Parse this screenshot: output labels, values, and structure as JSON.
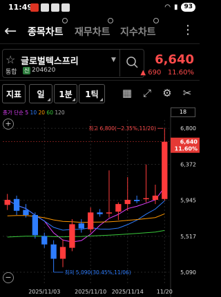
{
  "status": {
    "time": "11:49",
    "battery": "93"
  },
  "nav": {
    "tabs": [
      {
        "label": "종목차트"
      },
      {
        "label": "재무차트"
      },
      {
        "label": "지수차트"
      }
    ]
  },
  "stock": {
    "name": "글로벌텍스프리",
    "market": "통합",
    "credit_badge": "신",
    "code": "204620",
    "price": "6,640",
    "change": "▲ 690",
    "change_pct": "11.60%"
  },
  "toolbar": {
    "indicator": "지표",
    "day": "일",
    "minute": "1분",
    "tick": "1틱"
  },
  "indicators": {
    "prefix": "종가 단순",
    "ma": [
      {
        "label": "5",
        "color": "#e040fb"
      },
      {
        "label": "10",
        "color": "#2e7dff"
      },
      {
        "label": "20",
        "color": "#ff9800"
      },
      {
        "label": "60",
        "color": "#39c93b"
      },
      {
        "label": "120",
        "color": "#aaaaaa"
      }
    ],
    "count_badge": "18"
  },
  "colors": {
    "up": "#ff3b3b",
    "down": "#2e7dff"
  },
  "chart_data": {
    "type": "candlestick",
    "y_ticks": [
      "6,800",
      "6,372",
      "5,945",
      "5,517",
      "5,090"
    ],
    "ylim": [
      5000,
      6900
    ],
    "x_labels": [
      {
        "label": "2025/11/03",
        "index": 4
      },
      {
        "label": "2025/11/10",
        "index": 9
      },
      {
        "label": "2025/11/14",
        "index": 13
      },
      {
        "label": "11/20",
        "index": 17
      }
    ],
    "high_annotation": "최고 6,800(−2.35%,11/20)",
    "low_annotation": "최저 5,090(30.45%,11/06)",
    "current_price_label": "6,640",
    "current_pct_label": "11.60%",
    "candles": [
      {
        "o": 5890,
        "h": 6020,
        "l": 5830,
        "c": 5950
      },
      {
        "o": 5960,
        "h": 6000,
        "l": 5770,
        "c": 5820
      },
      {
        "o": 5830,
        "h": 5900,
        "l": 5740,
        "c": 5770
      },
      {
        "o": 5770,
        "h": 5800,
        "l": 5490,
        "c": 5530
      },
      {
        "o": 5520,
        "h": 5560,
        "l": 5380,
        "c": 5420
      },
      {
        "o": 5420,
        "h": 5470,
        "l": 5090,
        "c": 5250
      },
      {
        "o": 5250,
        "h": 5480,
        "l": 5150,
        "c": 5390
      },
      {
        "o": 5380,
        "h": 5720,
        "l": 5340,
        "c": 5660
      },
      {
        "o": 5670,
        "h": 5720,
        "l": 5560,
        "c": 5610
      },
      {
        "o": 5600,
        "h": 5860,
        "l": 5560,
        "c": 5800
      },
      {
        "o": 5800,
        "h": 5840,
        "l": 5750,
        "c": 5780
      },
      {
        "o": 5790,
        "h": 6300,
        "l": 5740,
        "c": 5800
      },
      {
        "o": 5810,
        "h": 5920,
        "l": 5710,
        "c": 5900
      },
      {
        "o": 5900,
        "h": 6220,
        "l": 5820,
        "c": 5950
      },
      {
        "o": 5950,
        "h": 6000,
        "l": 5910,
        "c": 5935
      },
      {
        "o": 5960,
        "h": 6370,
        "l": 5920,
        "c": 5970
      },
      {
        "o": 5950,
        "h": 6130,
        "l": 5900,
        "c": 6000
      },
      {
        "o": 5960,
        "h": 6800,
        "l": 5940,
        "c": 6640
      }
    ]
  }
}
